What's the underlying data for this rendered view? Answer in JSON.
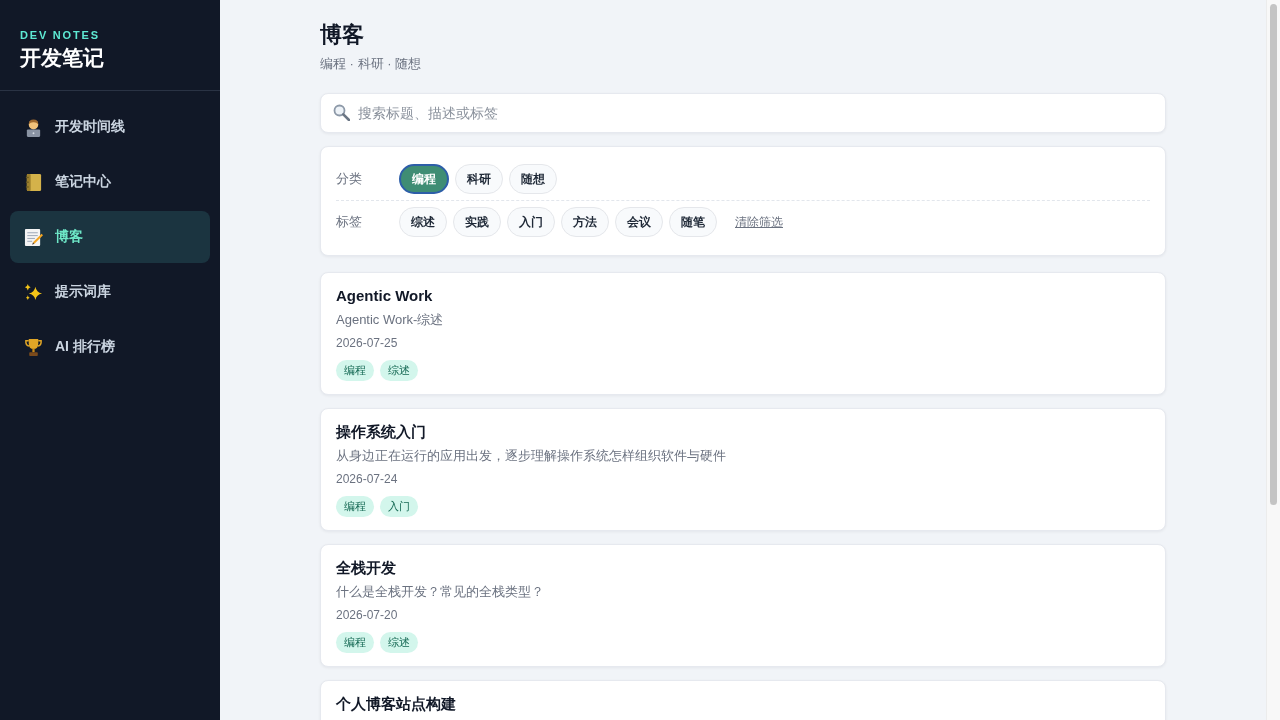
{
  "brand": {
    "eyebrow": "DEV NOTES",
    "title": "开发笔记"
  },
  "nav": [
    {
      "label": "开发时间线",
      "selected": false
    },
    {
      "label": "笔记中心",
      "selected": false
    },
    {
      "label": "博客",
      "selected": true
    },
    {
      "label": "提示词库",
      "selected": false
    },
    {
      "label": "AI 排行榜",
      "selected": false
    }
  ],
  "page": {
    "title": "博客",
    "subtitle": "编程 · 科研 · 随想"
  },
  "search": {
    "placeholder": "搜索标题、描述或标签"
  },
  "filters": {
    "category_label": "分类",
    "categories": [
      {
        "label": "编程",
        "selected": true
      },
      {
        "label": "科研",
        "selected": false
      },
      {
        "label": "随想",
        "selected": false
      }
    ],
    "tag_label": "标签",
    "tags": [
      {
        "label": "综述",
        "selected": false
      },
      {
        "label": "实践",
        "selected": false
      },
      {
        "label": "入门",
        "selected": false
      },
      {
        "label": "方法",
        "selected": false
      },
      {
        "label": "会议",
        "selected": false
      },
      {
        "label": "随笔",
        "selected": false
      }
    ],
    "clear": "清除筛选"
  },
  "posts": [
    {
      "title": "Agentic Work",
      "description": "Agentic Work-综述",
      "date": "2026-07-25",
      "tags": [
        "编程",
        "综述"
      ]
    },
    {
      "title": "操作系统入门",
      "description": "从身边正在运行的应用出发，逐步理解操作系统怎样组织软件与硬件",
      "date": "2026-07-24",
      "tags": [
        "编程",
        "入门"
      ]
    },
    {
      "title": "全栈开发",
      "description": "什么是全栈开发？常见的全栈类型？",
      "date": "2026-07-20",
      "tags": [
        "编程",
        "综述"
      ]
    },
    {
      "title": "个人博客站点构建"
    }
  ]
}
